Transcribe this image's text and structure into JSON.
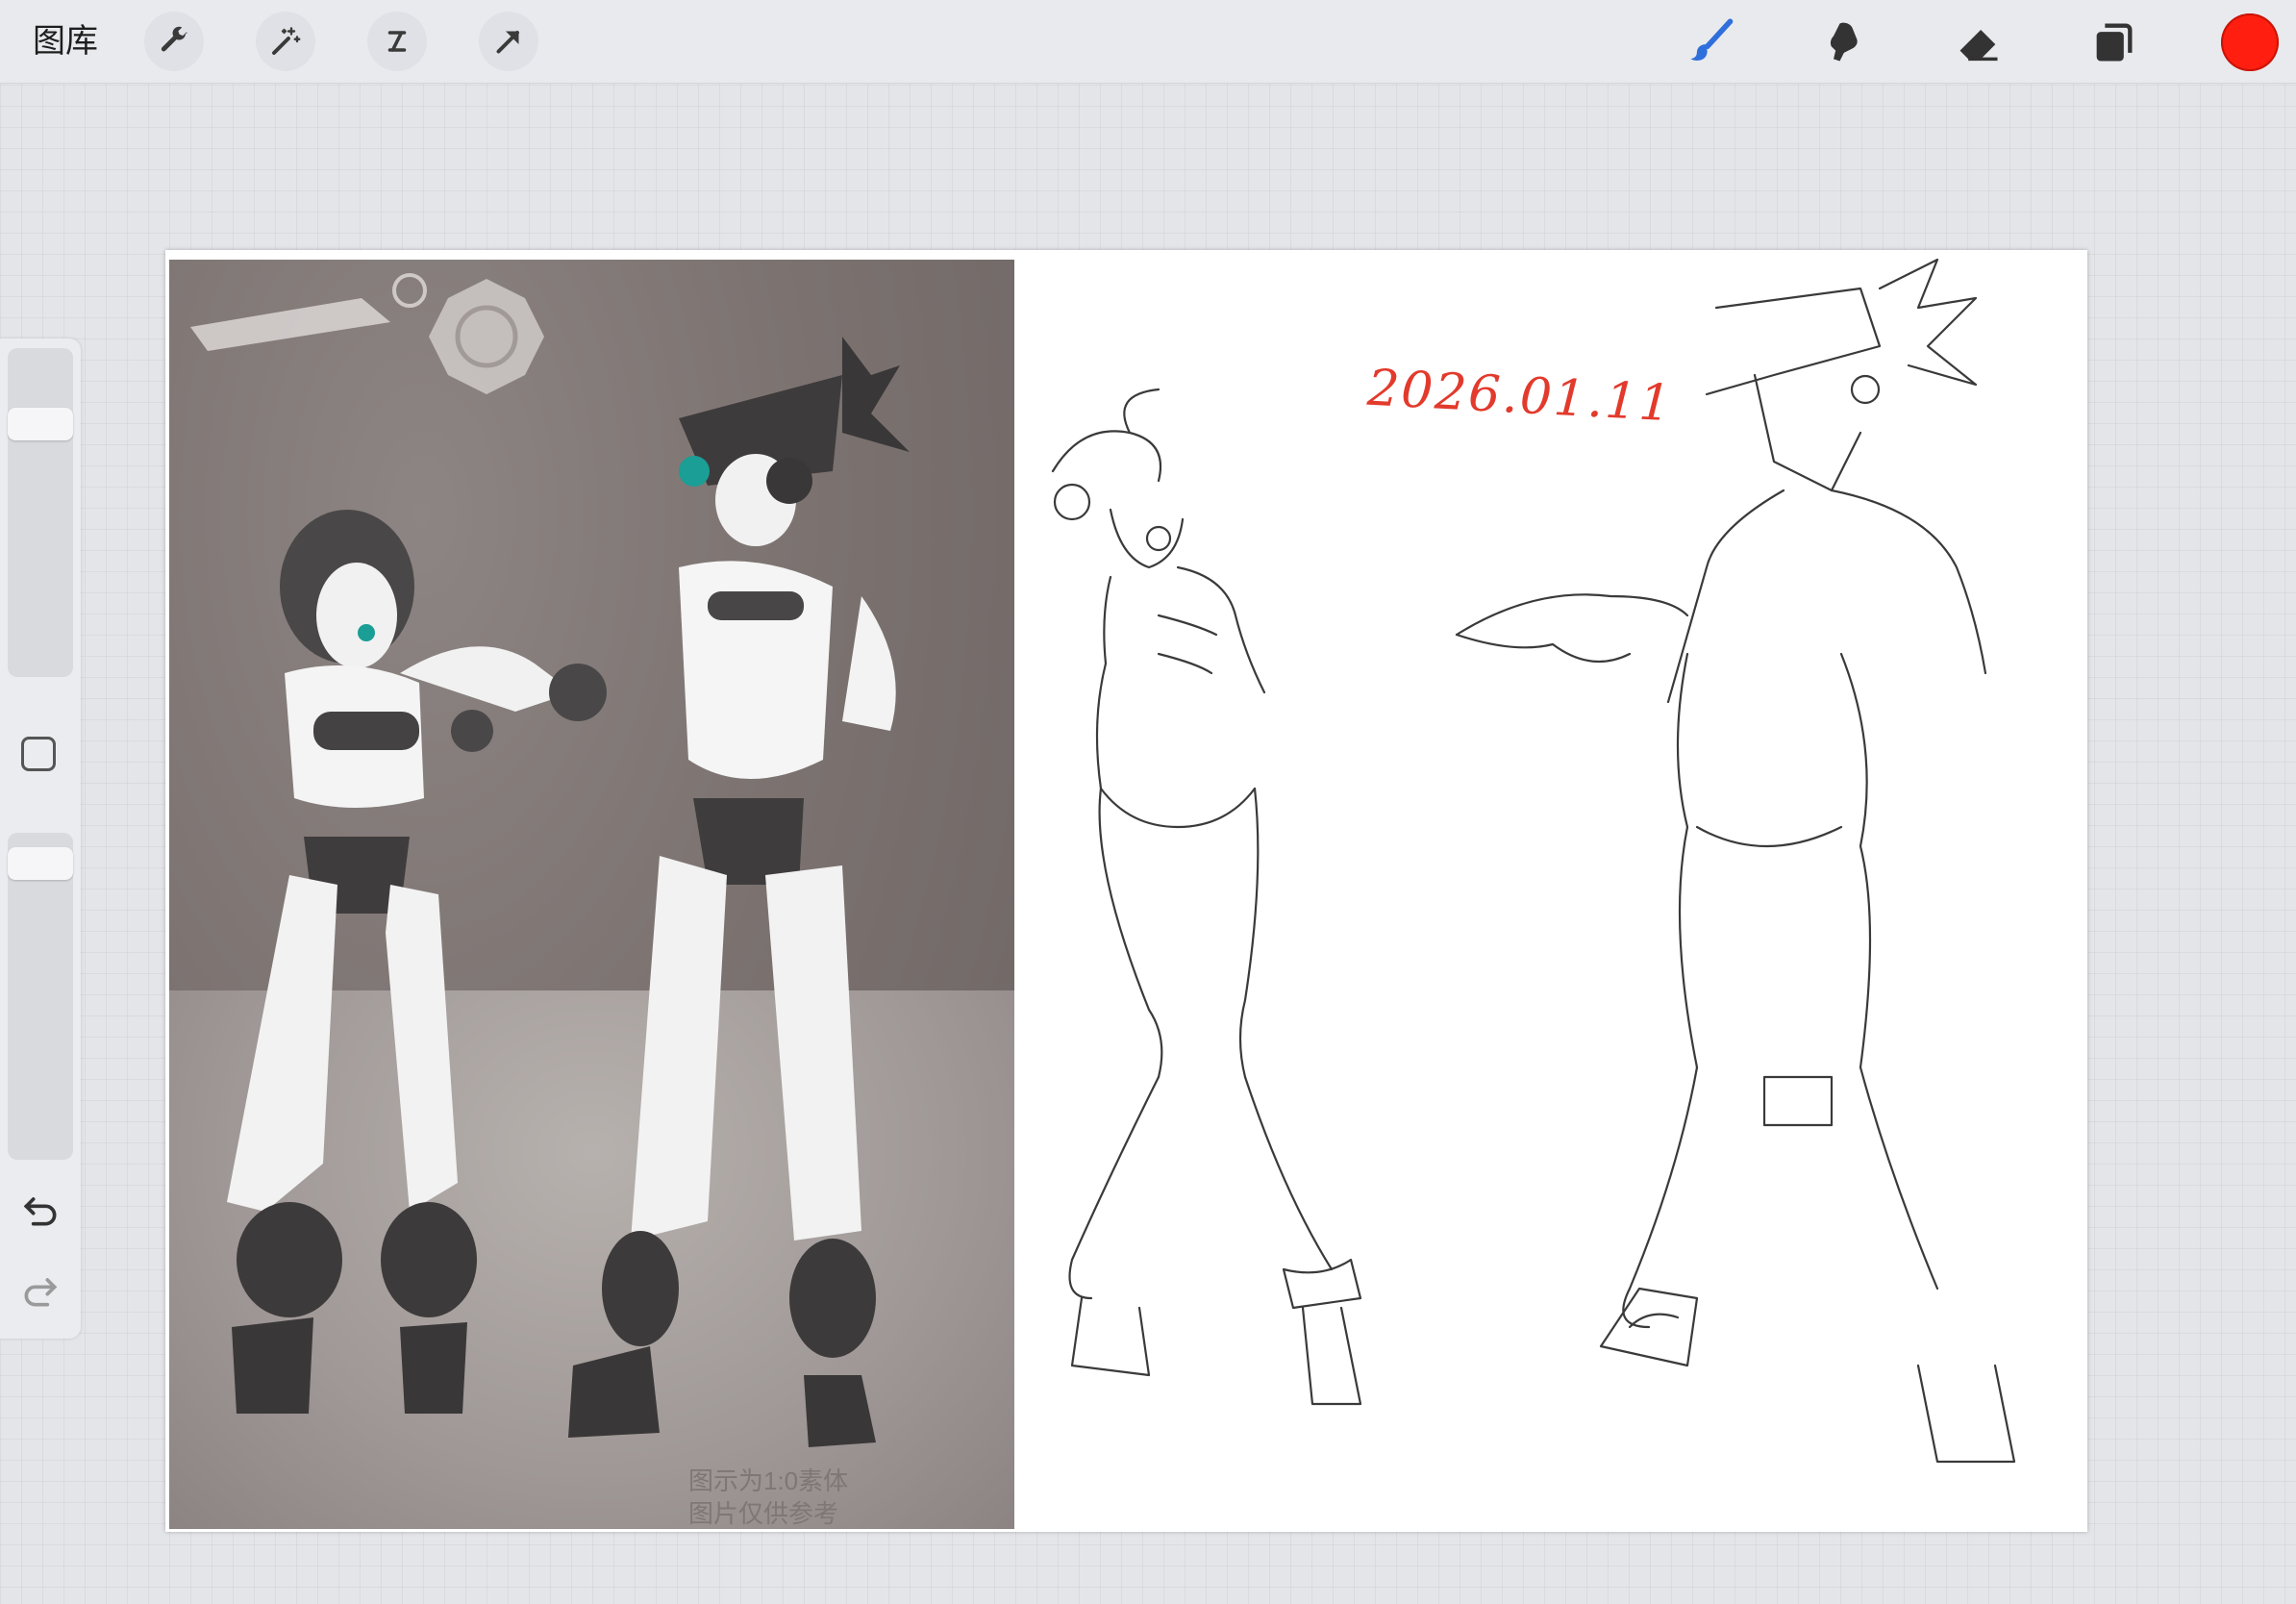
{
  "toolbar": {
    "gallery_label": "图库",
    "left_tools": [
      "wrench-icon",
      "magic-wand-icon",
      "selection-icon",
      "transform-arrow-icon"
    ],
    "right_tools": [
      "brush-icon",
      "smudge-icon",
      "eraser-icon",
      "layers-icon"
    ],
    "active_tool": "brush",
    "current_color": "#ff1e0f",
    "brush_color": "#2f6fdc"
  },
  "sidebar": {
    "brush_size_level": 0.8,
    "opacity_level": 0.95,
    "undo_icon": "undo-icon",
    "redo_icon": "redo-icon"
  },
  "canvas": {
    "photo": {
      "caption_line1": "图示为1:0素体",
      "caption_line2": "图片仅供参考"
    },
    "sketch": {
      "date_note": "2026.01.11"
    }
  }
}
